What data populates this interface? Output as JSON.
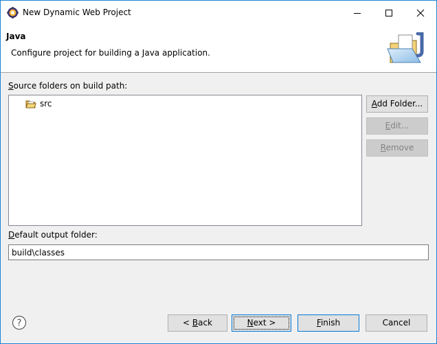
{
  "window": {
    "title": "New Dynamic Web Project"
  },
  "header": {
    "title": "Java",
    "description": "Configure project for building a Java application.",
    "image_icon": "java-project-folder-icon"
  },
  "source_folders": {
    "label_prefix": "S",
    "label_rest": "ource folders on build path:",
    "items": [
      {
        "name": "src",
        "icon": "source-folder-icon"
      }
    ]
  },
  "side_buttons": {
    "add_folder_prefix": "A",
    "add_folder_rest": "dd Folder...",
    "edit_prefix": "E",
    "edit_rest": "dit...",
    "remove_prefix": "R",
    "remove_rest": "emove"
  },
  "output": {
    "label_prefix": "D",
    "label_rest": "efault output folder:",
    "value": "build\\classes"
  },
  "footer": {
    "back_pre": "< ",
    "back_key": "B",
    "back_rest": "ack",
    "next_key": "N",
    "next_rest": "ext >",
    "finish_key": "F",
    "finish_rest": "inish",
    "cancel": "Cancel",
    "help_icon": "help-icon"
  },
  "colors": {
    "accent": "#0078d7",
    "window_border": "#1883d7",
    "dialog_bg": "#f0f0f0"
  }
}
